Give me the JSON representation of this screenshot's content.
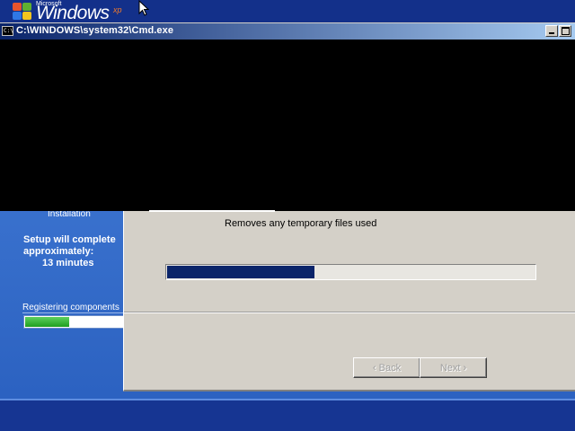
{
  "desktop": {
    "logo": {
      "microsoft": "Microsoft",
      "windows": "Windows",
      "xp": "xp"
    }
  },
  "setup": {
    "left_pane": {
      "step_label": "Installation",
      "estimate_line1": "Setup will complete approximately:",
      "estimate_minutes": "13 minutes",
      "status": "Registering components",
      "registration_progress": 0.45
    },
    "dialog": {
      "description": "Removes any temporary files used",
      "progress": 0.4,
      "back_label": "‹ Back",
      "next_label": "Next ›"
    }
  },
  "cmd_window": {
    "title": "C:\\WINDOWS\\system32\\Cmd.exe",
    "icon": "cmd-icon",
    "icon_text": "C:\\"
  },
  "colors": {
    "setup_blue": "#2a5fc0",
    "dialog_grey": "#d4d0c8",
    "progress_navy": "#0a246a",
    "reg_green": "#1f9e1f"
  }
}
